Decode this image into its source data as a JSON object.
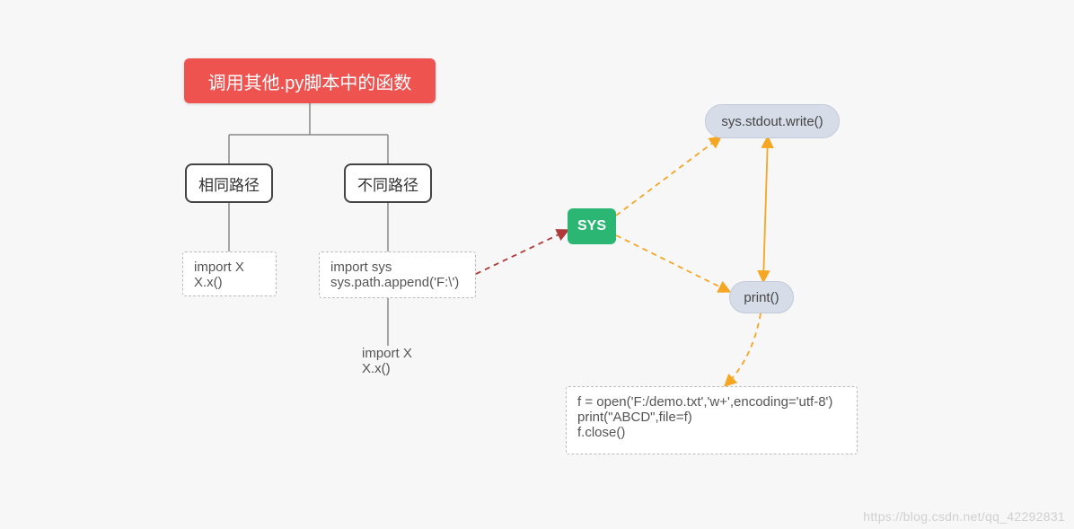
{
  "root": {
    "title": "调用其他.py脚本中的函数"
  },
  "branches": {
    "same_path": {
      "label": "相同路径",
      "code": "import X\nX.x()"
    },
    "diff_path": {
      "label": "不同路径",
      "code1": "import sys\nsys.path.append('F:\\')",
      "code2": "import X\nX.x()"
    }
  },
  "sys_node": {
    "label": "SYS"
  },
  "stdout_node": {
    "label": "sys.stdout.write()"
  },
  "print_node": {
    "label": "print()"
  },
  "file_code": "f = open('F:/demo.txt','w+',encoding='utf-8')\nprint(\"ABCD\",file=f)\nf.close()",
  "watermark": "https://blog.csdn.net/qq_42292831",
  "colors": {
    "root_bg": "#ef5350",
    "sys_bg": "#2bb673",
    "pill_bg": "#d7dde8",
    "tree_stroke": "#888",
    "orange_stroke": "#f5a623",
    "red_stroke": "#b03a3a"
  }
}
